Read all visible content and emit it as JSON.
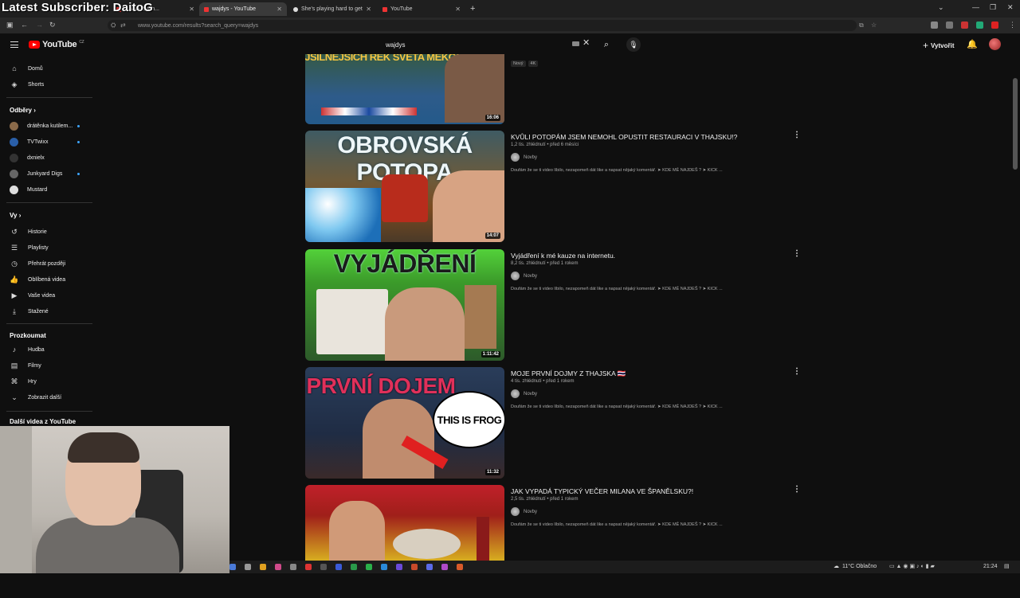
{
  "overlay": {
    "stream_title": "Latest Subscriber: DaitoG"
  },
  "browser": {
    "tabs": [
      {
        "label": "...ASA lety n..."
      },
      {
        "label": "wajdys - YouTube"
      },
      {
        "label": "She's playing hard to get"
      },
      {
        "label": "YouTube"
      }
    ],
    "url": "www.youtube.com/results?search_query=wajdys"
  },
  "header": {
    "logo": "YouTube",
    "logo_region": "CZ",
    "search_value": "wajdys",
    "create_label": "Vytvořit"
  },
  "sidebar": {
    "main": [
      {
        "label": "Domů",
        "icon": "home-icon"
      },
      {
        "label": "Shorts",
        "icon": "shorts-icon"
      }
    ],
    "subs_title": "Odběry",
    "subs": [
      {
        "label": "drátěnka kutilem...",
        "color": "#8a6a4a",
        "dot": true
      },
      {
        "label": "TVTwixx",
        "color": "#2a5fa8",
        "dot": true
      },
      {
        "label": "dxnielx",
        "color": "#333333",
        "dot": false
      },
      {
        "label": "Junkyard Digs",
        "color": "#666666",
        "dot": true
      },
      {
        "label": "Mustard",
        "color": "#dddddd",
        "dot": false
      }
    ],
    "you_title": "Vy",
    "you": [
      {
        "label": "Historie",
        "icon": "history-icon"
      },
      {
        "label": "Playlisty",
        "icon": "playlist-icon"
      },
      {
        "label": "Přehrát později",
        "icon": "clock-icon"
      },
      {
        "label": "Oblíbená videa",
        "icon": "thumbs-up-icon"
      },
      {
        "label": "Vaše videa",
        "icon": "video-icon"
      },
      {
        "label": "Stažené",
        "icon": "download-icon"
      }
    ],
    "explore_title": "Prozkoumat",
    "explore": [
      {
        "label": "Hudba",
        "icon": "music-icon"
      },
      {
        "label": "Filmy",
        "icon": "film-icon"
      },
      {
        "label": "Hry",
        "icon": "gamepad-icon"
      },
      {
        "label": "Zobrazit další",
        "icon": "chevron-down-icon"
      }
    ],
    "more_title": "Další videa z YouTube"
  },
  "videos": [
    {
      "thumb_text": "NEJSILNĚJŠÍCH ŘEK SVĚTA MEKONG",
      "duration": "16:06",
      "badges": [
        "Nový",
        "4K"
      ]
    },
    {
      "title": "KVŮLI POTOPÁM JSEM NEMOHL OPUSTIT RESTAURACI V THAJSKU!?",
      "meta": "1,2 tis. zhlédnutí • před 6 měsíci",
      "channel": "Novby",
      "desc": "Doufám že se ti video líbilo, nezapomeň dát like a napsat nějaký komentář. ➤ KDE MĚ NAJDEŠ ? ➤ KICK ...",
      "thumb_text": "OBROVSKÁ POTOPA",
      "duration": "14:07"
    },
    {
      "title": "Vyjádření k mé kauze na internetu.",
      "meta": "8,2 tis. zhlédnutí • před 1 rokem",
      "channel": "Novby",
      "desc": "Doufám že se ti video líbilo, nezapomeň dát like a napsat nějaký komentář. ➤ KDE MĚ NAJDEŠ ? ➤ KICK ...",
      "thumb_text": "VYJÁDŘENÍ",
      "duration": "1:11:42"
    },
    {
      "title": "MOJE PRVNÍ DOJMY Z THAJSKA 🇹🇭",
      "meta": "4 tis. zhlédnutí • před 1 rokem",
      "channel": "Novby",
      "desc": "Doufám že se ti video líbilo, nezapomeň dát like a napsat nějaký komentář. ➤ KDE MĚ NAJDEŠ ? ➤ KICK ...",
      "thumb_text": "PRVNÍ DOJEM",
      "bubble": "THIS IS FROG",
      "duration": "11:32"
    },
    {
      "title": "JAK VYPADÁ TYPICKÝ VEČER MILANA VE ŠPANĚLSKU?!",
      "meta": "2,5 tis. zhlédnutí • před 1 rokem",
      "channel": "Novby",
      "desc": "Doufám že se ti video líbilo, nezapomeň dát like a napsat nějaký komentář. ➤ KDE MĚ NAJDEŠ ? ➤ KICK ..."
    }
  ],
  "taskbar": {
    "weather": "11°C Oblačno",
    "time": "21:24"
  },
  "colors": {
    "bg": "#0f0f0f",
    "accent_red": "#ff0000",
    "link_blue": "#3ea6ff"
  }
}
